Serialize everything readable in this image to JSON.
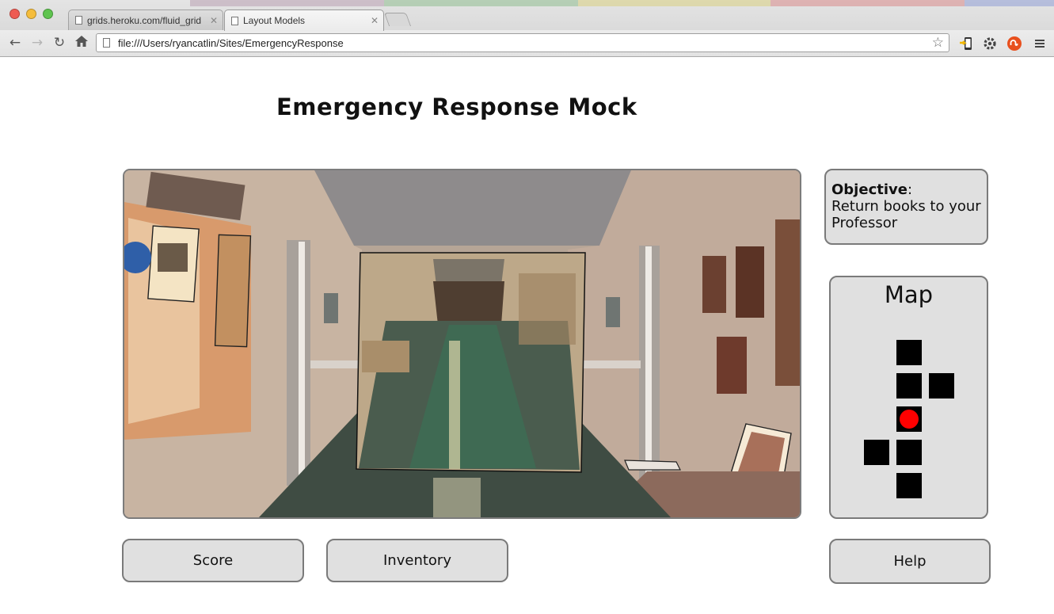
{
  "browser": {
    "tabs": [
      {
        "title": "grids.heroku.com/fluid_grid"
      },
      {
        "title": "Layout Models"
      }
    ],
    "address_bar": {
      "url": "file:///Users/ryancatlin/Sites/EmergencyResponse"
    },
    "icons": [
      "back-icon",
      "forward-icon",
      "reload-icon",
      "home-icon",
      "page-icon",
      "star-icon",
      "extension-icon",
      "wrench-icon",
      "stumbleupon-icon",
      "menu-icon"
    ]
  },
  "page": {
    "title": "Emergency Response Mock",
    "scene_image": "school-hallway-scene"
  },
  "objective": {
    "heading": "Objective",
    "suffix": ":",
    "text": "Return books to your Professor"
  },
  "map": {
    "title": "Map",
    "player_color": "#ff0000",
    "cell_color": "#000000"
  },
  "buttons": {
    "score": "Score",
    "inventory": "Inventory",
    "help": "Help"
  }
}
